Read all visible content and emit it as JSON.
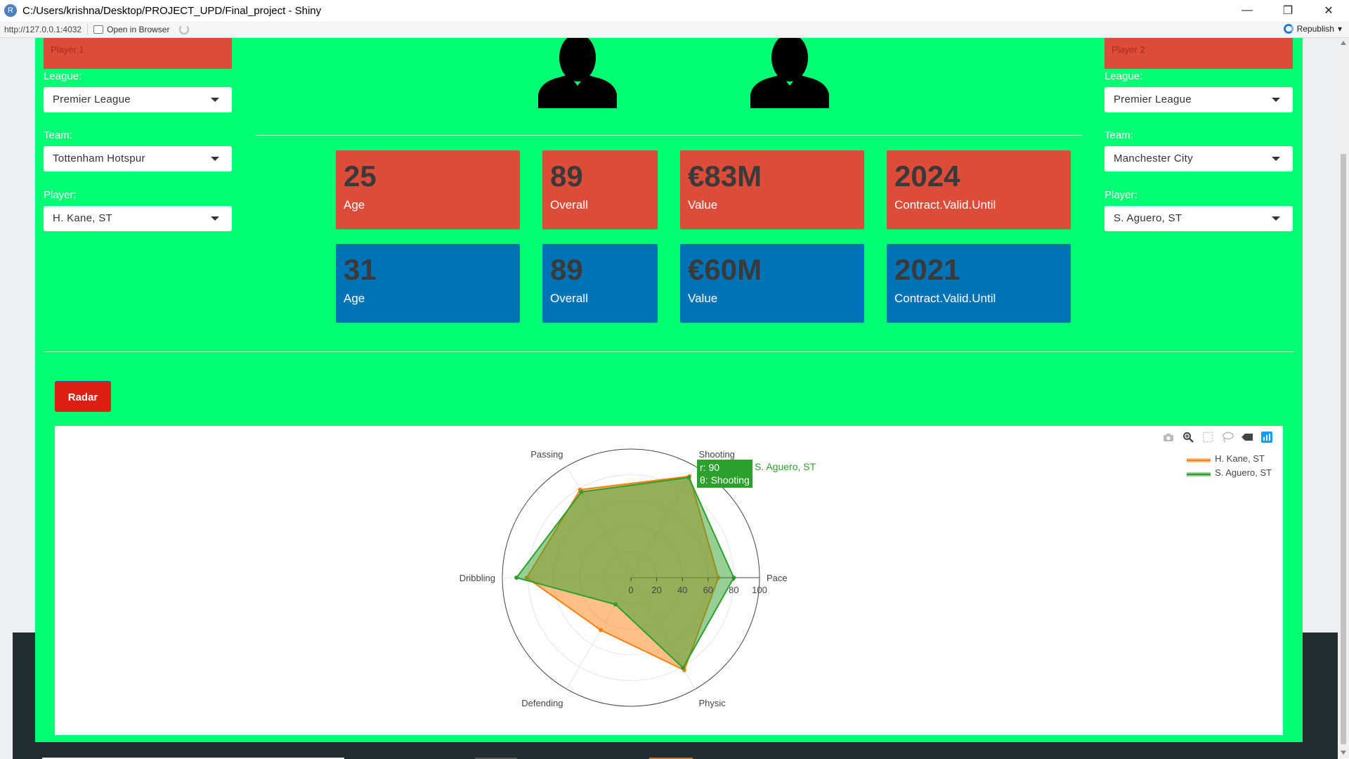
{
  "window": {
    "title": "C:/Users/krishna/Desktop/PROJECT_UPD/Final_project - Shiny",
    "app_icon": "R"
  },
  "toolbar": {
    "url": "http://127.0.0.1:4032",
    "open_browser": "Open in Browser",
    "republish": "Republish"
  },
  "left": {
    "box_label": "Player 1",
    "league_label": "League:",
    "league_value": "Premier League",
    "team_label": "Team:",
    "team_value": "Tottenham Hotspur",
    "player_label": "Player:",
    "player_value": "H. Kane, ST"
  },
  "right": {
    "box_label": "Player 2",
    "league_label": "League:",
    "league_value": "Premier League",
    "team_label": "Team:",
    "team_value": "Manchester City",
    "player_label": "Player:",
    "player_value": "S. Aguero, ST"
  },
  "player1_boxes": [
    {
      "value": "25",
      "label": "Age"
    },
    {
      "value": "89",
      "label": "Overall"
    },
    {
      "value": "€83M",
      "label": "Value"
    },
    {
      "value": "2024",
      "label": "Contract.Valid.Until"
    }
  ],
  "player2_boxes": [
    {
      "value": "31",
      "label": "Age"
    },
    {
      "value": "89",
      "label": "Overall"
    },
    {
      "value": "€60M",
      "label": "Value"
    },
    {
      "value": "2021",
      "label": "Contract.Valid.Until"
    }
  ],
  "radar_button": "Radar",
  "colors": {
    "panel": "#00ff73",
    "red_box": "#dd4b39",
    "blue_box": "#0073b7",
    "kane": "#ff7f0e",
    "aguero": "#2ca02c"
  },
  "modebar_icons": [
    "camera-icon",
    "zoom-icon",
    "box-select-icon",
    "lasso-icon",
    "compare-icon",
    "plotly-logo-icon"
  ],
  "hover": {
    "r_line": "r: 90",
    "theta_line": "θ: Shooting",
    "series": "S. Aguero, ST"
  },
  "chart_data": {
    "type": "radar",
    "categories": [
      "Pace",
      "Shooting",
      "Passing",
      "Dribbling",
      "Defending",
      "Physic"
    ],
    "radial_ticks": [
      "0",
      "20",
      "40",
      "60",
      "80",
      "100"
    ],
    "rlim": [
      0,
      100
    ],
    "legend_position": "top-right",
    "series": [
      {
        "name": "H. Kane, ST",
        "values": [
          68,
          91,
          79,
          81,
          47,
          83
        ],
        "color": "#ff7f0e"
      },
      {
        "name": "S. Aguero, ST",
        "values": [
          80,
          90,
          77,
          89,
          24,
          81
        ],
        "color": "#2ca02c"
      }
    ]
  }
}
